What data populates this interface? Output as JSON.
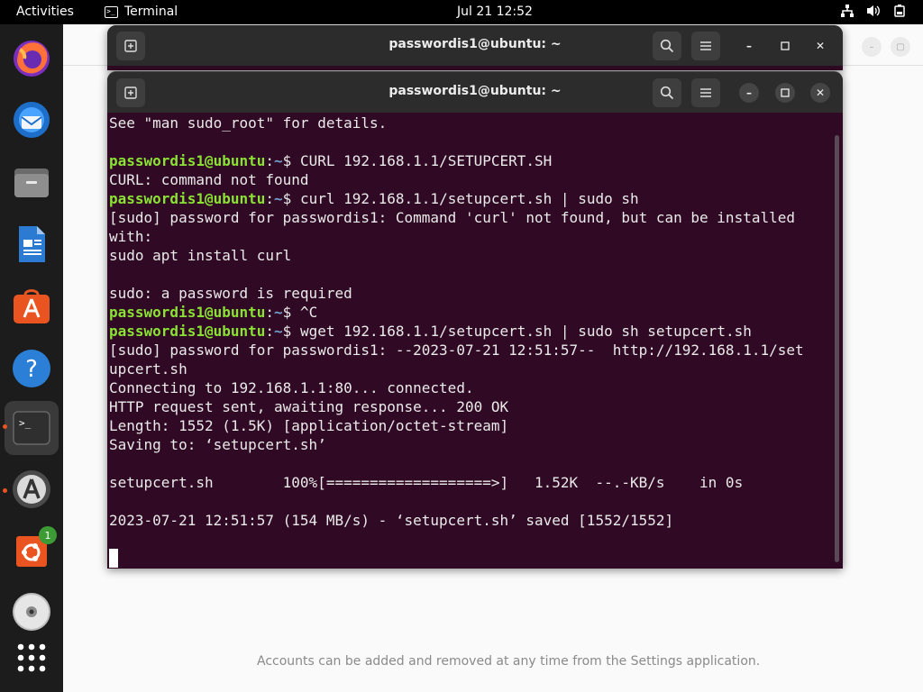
{
  "topbar": {
    "activities": "Activities",
    "app_name": "Terminal",
    "app_icon_glyph": ">_",
    "clock": "Jul 21  12:52",
    "tray_icons": [
      "network-icon",
      "volume-icon",
      "power-icon"
    ]
  },
  "dock": {
    "items": [
      {
        "name": "firefox-icon"
      },
      {
        "name": "thunderbird-icon"
      },
      {
        "name": "files-icon"
      },
      {
        "name": "writer-icon"
      },
      {
        "name": "app-center-icon"
      },
      {
        "name": "help-icon"
      },
      {
        "name": "terminal-icon",
        "active": true,
        "running": true
      },
      {
        "name": "software-updater-icon",
        "running": true
      },
      {
        "name": "ubuntu-install-icon",
        "badge": "1"
      },
      {
        "name": "disc-icon"
      },
      {
        "name": "show-apps-icon"
      }
    ]
  },
  "background_window": {
    "notice": "Accounts can be added and removed at any time from the Settings application."
  },
  "terminal_back": {
    "title": "passwordis1@ubuntu: ~"
  },
  "terminal_front": {
    "title": "passwordis1@ubuntu: ~",
    "prompt_user": "passwordis1@ubuntu",
    "prompt_sep": ":",
    "prompt_path": "~",
    "prompt_end": "$ ",
    "lines": [
      {
        "text": "See \"man sudo_root\" for details."
      },
      {
        "text": ""
      },
      {
        "prompt": true,
        "cmd": "CURL 192.168.1.1/SETUPCERT.SH"
      },
      {
        "text": "CURL: command not found"
      },
      {
        "prompt": true,
        "cmd": "curl 192.168.1.1/setupcert.sh | sudo sh"
      },
      {
        "text": "[sudo] password for passwordis1: Command 'curl' not found, but can be installed"
      },
      {
        "text": "with:"
      },
      {
        "text": "sudo apt install curl"
      },
      {
        "text": ""
      },
      {
        "text": "sudo: a password is required"
      },
      {
        "prompt": true,
        "cmd": "^C"
      },
      {
        "prompt": true,
        "cmd": "wget 192.168.1.1/setupcert.sh | sudo sh setupcert.sh"
      },
      {
        "text": "[sudo] password for passwordis1: --2023-07-21 12:51:57--  http://192.168.1.1/set"
      },
      {
        "text": "upcert.sh"
      },
      {
        "text": "Connecting to 192.168.1.1:80... connected."
      },
      {
        "text": "HTTP request sent, awaiting response... 200 OK"
      },
      {
        "text": "Length: 1552 (1.5K) [application/octet-stream]"
      },
      {
        "text": "Saving to: ‘setupcert.sh’"
      },
      {
        "text": ""
      },
      {
        "text": "setupcert.sh        100%[===================>]   1.52K  --.-KB/s    in 0s"
      },
      {
        "text": ""
      },
      {
        "text": "2023-07-21 12:51:57 (154 MB/s) - ‘setupcert.sh’ saved [1552/1552]"
      },
      {
        "text": ""
      },
      {
        "cursor": true
      }
    ]
  },
  "colors": {
    "terminal_bg": "#300a24",
    "prompt_user": "#8ae234",
    "prompt_path": "#729fcf",
    "ubuntu_orange": "#e95420"
  }
}
